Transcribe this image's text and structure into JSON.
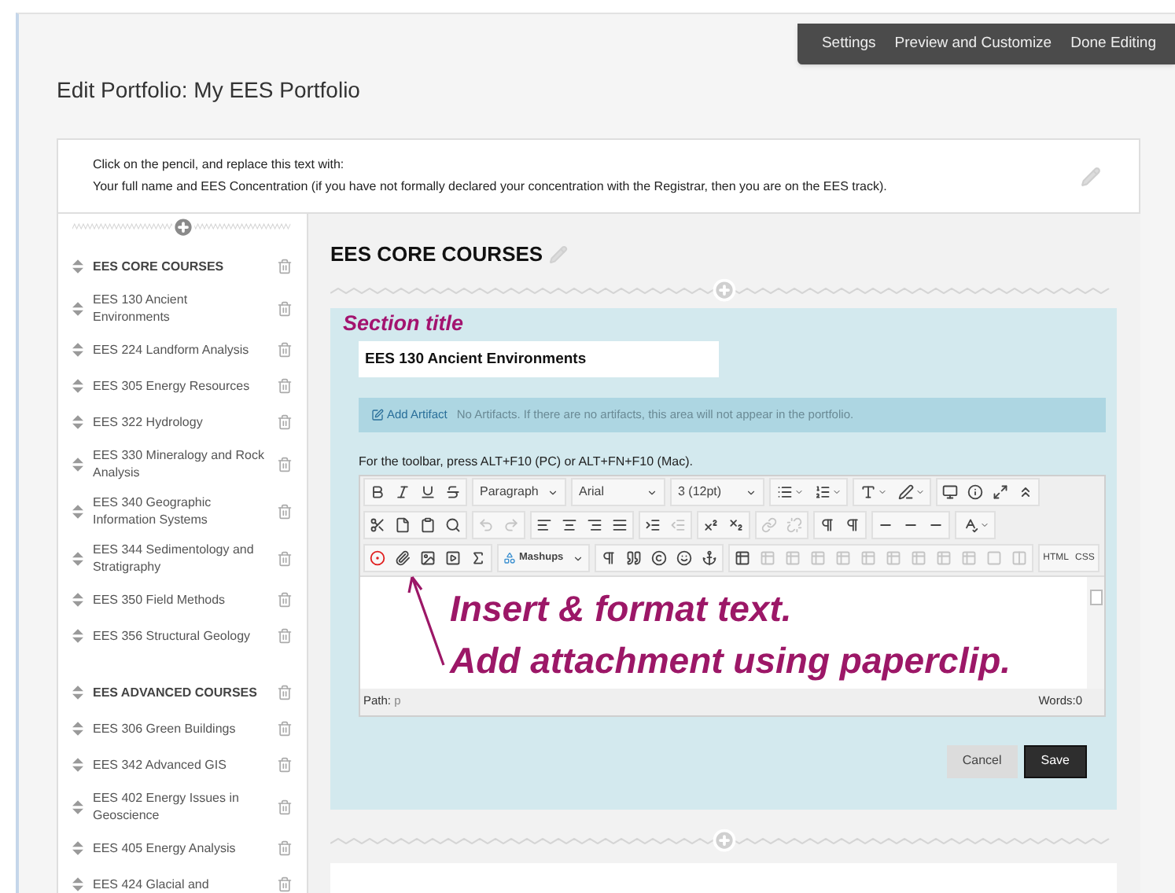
{
  "top_bar": {
    "links": [
      "Settings",
      "Preview and Customize",
      "Done Editing"
    ]
  },
  "page_title": "Edit Portfolio: My EES Portfolio",
  "intro": {
    "lines": [
      "Click on the pencil, and replace this text with:",
      "Your full name and EES Concentration (if you have not formally declared your concentration with the Registrar, then you are on the EES track)."
    ]
  },
  "sidebar": {
    "items": [
      {
        "kind": "section",
        "label": "EES CORE COURSES"
      },
      {
        "kind": "item",
        "label": "EES 130 Ancient Environments"
      },
      {
        "kind": "item",
        "label": "EES 224 Landform Analysis"
      },
      {
        "kind": "item",
        "label": "EES 305 Energy Resources"
      },
      {
        "kind": "item",
        "label": "EES 322 Hydrology"
      },
      {
        "kind": "item",
        "label": "EES 330 Mineralogy and Rock Analysis"
      },
      {
        "kind": "item",
        "label": "EES 340 Geographic Information Systems"
      },
      {
        "kind": "item",
        "label": "EES 344 Sedimentology and Stratigraphy"
      },
      {
        "kind": "item",
        "label": "EES 350 Field Methods"
      },
      {
        "kind": "item",
        "label": "EES 356 Structural Geology"
      },
      {
        "kind": "section",
        "label": "EES ADVANCED COURSES"
      },
      {
        "kind": "item",
        "label": "EES 306 Green Buildings"
      },
      {
        "kind": "item",
        "label": "EES 342 Advanced GIS"
      },
      {
        "kind": "item",
        "label": "EES 402 Energy Issues in Geoscience"
      },
      {
        "kind": "item",
        "label": "EES 405 Energy Analysis"
      },
      {
        "kind": "item",
        "label": "EES 424 Glacial and"
      }
    ]
  },
  "section": {
    "heading": "EES CORE COURSES",
    "callout": "Section title",
    "title_field": {
      "value": "EES 130 Ancient Environments"
    },
    "artifacts": {
      "link": "Add Artifact",
      "message": "No Artifacts. If there are no artifacts, this area will not appear in the portfolio."
    },
    "toolbar_hint": "For the toolbar, press ALT+F10 (PC) or ALT+FN+F10 (Mac).",
    "editor": {
      "toolbar": [
        [
          [
            {
              "kind": "icon",
              "disabled": false
            },
            {
              "kind": "icon",
              "disabled": false
            },
            {
              "kind": "icon",
              "disabled": false
            },
            {
              "kind": "icon",
              "disabled": false
            }
          ],
          [
            {
              "kind": "select",
              "value": "Paragraph",
              "disabled": false
            }
          ],
          [
            {
              "kind": "select",
              "value": "Arial",
              "disabled": false
            }
          ],
          [
            {
              "kind": "select",
              "value": "3 (12pt)",
              "disabled": false
            }
          ],
          [
            {
              "kind": "icon-menu",
              "disabled": false
            },
            {
              "kind": "icon-menu",
              "disabled": false
            }
          ],
          [
            {
              "kind": "icon-menu",
              "disabled": false
            },
            {
              "kind": "icon-menu",
              "disabled": false
            }
          ],
          [
            {
              "kind": "icon",
              "disabled": false
            },
            {
              "kind": "icon",
              "disabled": false
            },
            {
              "kind": "icon",
              "disabled": false
            },
            {
              "kind": "icon",
              "disabled": false
            }
          ]
        ],
        [
          [
            {
              "kind": "icon",
              "disabled": false
            },
            {
              "kind": "icon",
              "disabled": false
            },
            {
              "kind": "icon",
              "disabled": false
            },
            {
              "kind": "icon",
              "disabled": false
            }
          ],
          [
            {
              "kind": "icon",
              "disabled": true
            },
            {
              "kind": "icon",
              "disabled": true
            }
          ],
          [
            {
              "kind": "icon",
              "disabled": false
            },
            {
              "kind": "icon",
              "disabled": false
            },
            {
              "kind": "icon",
              "disabled": false
            },
            {
              "kind": "icon",
              "disabled": false
            }
          ],
          [
            {
              "kind": "icon",
              "disabled": false
            },
            {
              "kind": "icon",
              "disabled": true
            }
          ],
          [
            {
              "kind": "icon",
              "disabled": false
            },
            {
              "kind": "icon",
              "disabled": false
            }
          ],
          [
            {
              "kind": "icon",
              "disabled": true
            },
            {
              "kind": "icon",
              "disabled": true
            }
          ],
          [
            {
              "kind": "icon",
              "disabled": false
            },
            {
              "kind": "icon",
              "disabled": false
            }
          ],
          [
            {
              "kind": "icon",
              "disabled": false
            },
            {
              "kind": "icon",
              "disabled": false
            },
            {
              "kind": "icon",
              "disabled": false
            }
          ],
          [
            {
              "kind": "icon-menu",
              "disabled": false
            }
          ]
        ],
        [
          [
            {
              "kind": "icon",
              "disabled": false
            },
            {
              "kind": "icon",
              "disabled": false
            },
            {
              "kind": "icon",
              "disabled": false
            },
            {
              "kind": "icon",
              "disabled": false
            },
            {
              "kind": "icon",
              "disabled": false
            }
          ],
          [
            {
              "kind": "icon-select",
              "value": "Mashups",
              "disabled": false
            }
          ],
          [
            {
              "kind": "icon",
              "disabled": false
            },
            {
              "kind": "icon",
              "disabled": false
            },
            {
              "kind": "icon",
              "disabled": false
            },
            {
              "kind": "icon",
              "disabled": false
            },
            {
              "kind": "icon",
              "disabled": false
            }
          ],
          [
            {
              "kind": "icon",
              "disabled": false
            },
            {
              "kind": "icon",
              "disabled": true
            },
            {
              "kind": "icon",
              "disabled": true
            },
            {
              "kind": "icon",
              "disabled": true
            },
            {
              "kind": "icon",
              "disabled": true
            },
            {
              "kind": "icon",
              "disabled": true
            },
            {
              "kind": "icon",
              "disabled": true
            },
            {
              "kind": "icon",
              "disabled": true
            },
            {
              "kind": "icon",
              "disabled": true
            },
            {
              "kind": "icon",
              "disabled": true
            },
            {
              "kind": "icon",
              "disabled": true
            },
            {
              "kind": "icon",
              "disabled": true
            }
          ],
          [
            {
              "kind": "label",
              "value": "HTML",
              "disabled": false
            },
            {
              "kind": "label",
              "value": "CSS",
              "disabled": false
            }
          ]
        ]
      ],
      "notes": [
        "Insert & format text.",
        "Add attachment using paperclip."
      ],
      "path_label": "Path:",
      "path": "p",
      "words": "Words:0"
    },
    "buttons": [
      {
        "kind": "secondary",
        "label": "Cancel"
      },
      {
        "kind": "primary",
        "label": "Save"
      }
    ]
  }
}
